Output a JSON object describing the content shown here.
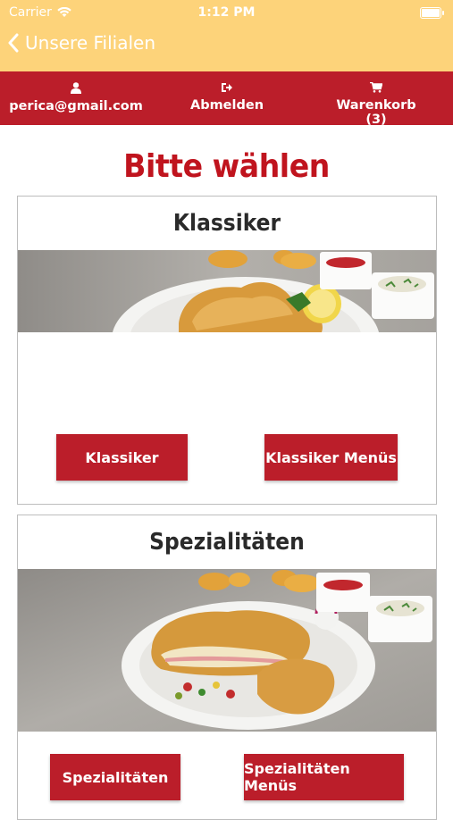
{
  "status_bar": {
    "carrier": "Carrier",
    "time": "1:12 PM"
  },
  "nav": {
    "back_label": "Unsere Filialen"
  },
  "account_bar": {
    "user_email": "perica@gmail.com",
    "logout_label": "Abmelden",
    "cart_label": "Warenkorb (3)"
  },
  "page": {
    "title": "Bitte wählen"
  },
  "categories": [
    {
      "heading": "Klassiker",
      "button_1": "Klassiker",
      "button_2": "Klassiker Menüs"
    },
    {
      "heading": "Spezialitäten",
      "button_1": "Spezialitäten",
      "button_2": "Spezialitäten Menüs"
    }
  ],
  "colors": {
    "nav_bg": "#fdd37a",
    "brand_red": "#bb1e2a",
    "title_red": "#c0141e"
  },
  "icons": [
    "wifi-icon",
    "battery-icon",
    "back-chevron-icon",
    "user-icon",
    "logout-icon",
    "cart-icon"
  ]
}
